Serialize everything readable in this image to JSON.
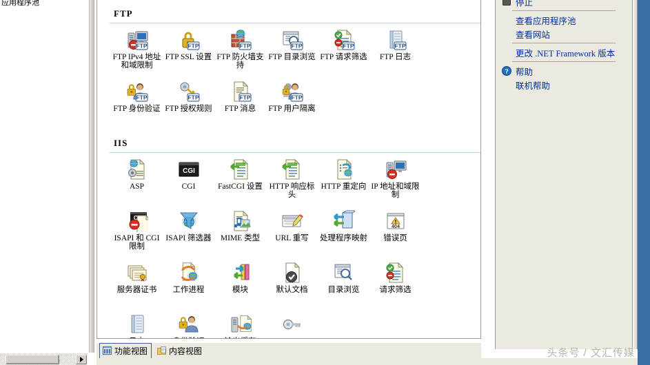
{
  "window": {
    "tree_clipped_label": "应用程序池",
    "watermark": "头条号 / 文汇传媒"
  },
  "center": {
    "sections": [
      {
        "title": "FTP",
        "tiles": [
          {
            "label": "FTP IPv4 地址和域限制",
            "icon": "server-monitor-deny-ftp-icon"
          },
          {
            "label": "FTP SSL 设置",
            "icon": "padlock-ftp-icon"
          },
          {
            "label": "FTP 防火墙支持",
            "icon": "firewall-globe-ftp-icon"
          },
          {
            "label": "FTP 目录浏览",
            "icon": "window-magnifier-ftp-icon"
          },
          {
            "label": "FTP 请求筛选",
            "icon": "document-filter-ftp-icon"
          },
          {
            "label": "FTP 日志",
            "icon": "notebook-ftp-icon"
          },
          {
            "label": "FTP 身份验证",
            "icon": "user-padlock-ftp-icon"
          },
          {
            "label": "FTP 授权规则",
            "icon": "key-ftp-icon"
          },
          {
            "label": "FTP 消息",
            "icon": "document-text-ftp-icon"
          },
          {
            "label": "FTP 用户隔离",
            "icon": "users-padlock-ftp-icon"
          }
        ]
      },
      {
        "title": "IIS",
        "tiles": [
          {
            "label": "ASP",
            "icon": "asp-document-globe-gear-icon"
          },
          {
            "label": "CGI",
            "icon": "cgi-console-icon"
          },
          {
            "label": "FastCGI 设置",
            "icon": "fastcgi-document-arrow-icon"
          },
          {
            "label": "HTTP 响应标头",
            "icon": "http-response-headers-icon"
          },
          {
            "label": "HTTP 重定向",
            "icon": "http-redirect-icon"
          },
          {
            "label": "IP 地址和域限制",
            "icon": "server-monitor-deny-icon"
          },
          {
            "label": "ISAPI 和 CGI 限制",
            "icon": "cgi-console-deny-icon"
          },
          {
            "label": "ISAPI 筛选器",
            "icon": "funnel-globe-icon"
          },
          {
            "label": "MIME 类型",
            "icon": "mime-types-icon"
          },
          {
            "label": "URL 重写",
            "icon": "url-rewrite-pencil-icon"
          },
          {
            "label": "处理程序映射",
            "icon": "handler-mappings-icon"
          },
          {
            "label": "错误页",
            "icon": "error-pages-404-icon"
          },
          {
            "label": "服务器证书",
            "icon": "server-certificates-icon"
          },
          {
            "label": "工作进程",
            "icon": "worker-processes-icon"
          },
          {
            "label": "模块",
            "icon": "modules-arrows-icon"
          },
          {
            "label": "默认文档",
            "icon": "default-document-check-icon"
          },
          {
            "label": "目录浏览",
            "icon": "directory-browsing-icon"
          },
          {
            "label": "请求筛选",
            "icon": "request-filtering-icon"
          },
          {
            "label": "日志",
            "icon": "logging-notebook-icon"
          },
          {
            "label": "身份验证",
            "icon": "authentication-user-padlock-icon"
          },
          {
            "label": "输出缓存",
            "icon": "output-caching-icon"
          },
          {
            "label": "",
            "icon": "ssl-settings-key-icon"
          }
        ]
      }
    ]
  },
  "tabs": [
    {
      "label": "功能视图",
      "icon": "features-view-icon",
      "active": true
    },
    {
      "label": "内容视图",
      "icon": "content-view-icon",
      "active": false
    }
  ],
  "actions": {
    "groups": [
      {
        "items": [
          {
            "label": "停止",
            "icon": "stop-square-icon"
          }
        ]
      },
      {
        "items": [
          {
            "label": "查看应用程序池",
            "icon": "none"
          },
          {
            "label": "查看网站",
            "icon": "none"
          }
        ]
      },
      {
        "items": [
          {
            "label": "更改 .NET Framework 版本",
            "icon": "none",
            "mono": true
          }
        ]
      },
      {
        "items": [
          {
            "label": "帮助",
            "icon": "help-question-icon"
          },
          {
            "label": "联机帮助",
            "icon": "none"
          }
        ]
      }
    ]
  },
  "colors": {
    "link": "#00309c",
    "panel": "#ece9e0",
    "desktop": "#3a6ea5",
    "section_rule": "#b8d0e8"
  }
}
